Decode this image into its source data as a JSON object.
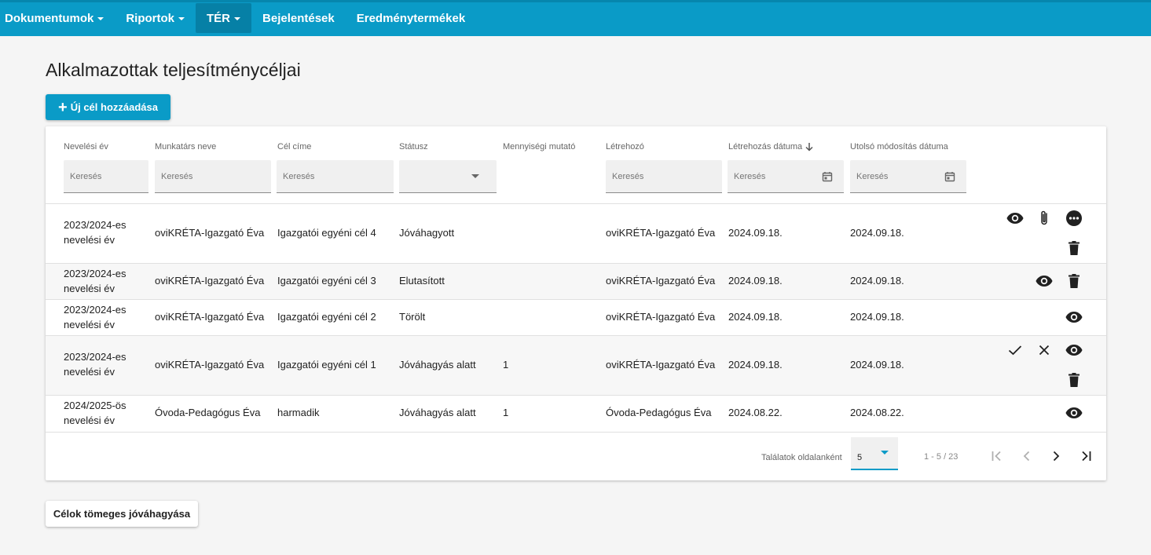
{
  "nav": {
    "items": [
      {
        "label": "Dokumentumok",
        "has_caret": true
      },
      {
        "label": "Riportok",
        "has_caret": true
      },
      {
        "label": "TÉR",
        "has_caret": true,
        "active": true
      },
      {
        "label": "Bejelentések",
        "has_caret": false
      },
      {
        "label": "Eredménytermékek",
        "has_caret": false
      }
    ]
  },
  "page": {
    "title": "Alkalmazottak teljesítménycéljai",
    "add_button_label": "Új cél hozzáadása",
    "bulk_approve_label": "Célok tömeges jóváhagyása"
  },
  "table": {
    "columns": [
      "Nevelési év",
      "Munkatárs neve",
      "Cél címe",
      "Státusz",
      "Mennyiségi mutató",
      "Létrehozó",
      "Létrehozás dátuma",
      "Utolsó módosítás dátuma"
    ],
    "sort_icon": "arrow-down-icon",
    "filter_placeholder": "Keresés",
    "rows": [
      {
        "year_1": "2023/2024-es",
        "year_2": "nevelési év",
        "employee": "oviKRÉTA-Igazgató Éva",
        "goal": "Igazgatói egyéni cél 4",
        "status": "Jóváhagyott",
        "quantity": "",
        "creator": "oviKRÉTA-Igazgató Éva",
        "created": "2024.09.18.",
        "modified": "2024.09.18.",
        "actions": [
          "eye-icon",
          "paperclip-icon",
          "more-icon",
          "trash-icon"
        ]
      },
      {
        "year_1": "2023/2024-es",
        "year_2": "nevelési év",
        "employee": "oviKRÉTA-Igazgató Éva",
        "goal": "Igazgatói egyéni cél 3",
        "status": "Elutasított",
        "quantity": "",
        "creator": "oviKRÉTA-Igazgató Éva",
        "created": "2024.09.18.",
        "modified": "2024.09.18.",
        "actions": [
          "eye-icon",
          "trash-icon"
        ]
      },
      {
        "year_1": "2023/2024-es",
        "year_2": "nevelési év",
        "employee": "oviKRÉTA-Igazgató Éva",
        "goal": "Igazgatói egyéni cél 2",
        "status": "Törölt",
        "quantity": "",
        "creator": "oviKRÉTA-Igazgató Éva",
        "created": "2024.09.18.",
        "modified": "2024.09.18.",
        "actions": [
          "eye-icon"
        ]
      },
      {
        "year_1": "2023/2024-es",
        "year_2": "nevelési év",
        "employee": "oviKRÉTA-Igazgató Éva",
        "goal": "Igazgatói egyéni cél 1",
        "status": "Jóváhagyás alatt",
        "quantity": "1",
        "creator": "oviKRÉTA-Igazgató Éva",
        "created": "2024.09.18.",
        "modified": "2024.09.18.",
        "actions": [
          "check-icon",
          "close-icon",
          "eye-icon",
          "trash-icon"
        ]
      },
      {
        "year_1": "2024/2025-ös",
        "year_2": "nevelési év",
        "employee": "Óvoda-Pedagógus Éva",
        "goal": "harmadik",
        "status": "Jóváhagyás alatt",
        "quantity": "1",
        "creator": "Óvoda-Pedagógus Éva",
        "created": "2024.08.22.",
        "modified": "2024.08.22.",
        "actions": [
          "eye-icon"
        ]
      }
    ]
  },
  "pager": {
    "label": "Találatok oldalanként",
    "page_size": "5",
    "range": "1 - 5 / 23"
  },
  "colors": {
    "accent": "#0a9bc7",
    "nav_active": "#0680a6"
  }
}
